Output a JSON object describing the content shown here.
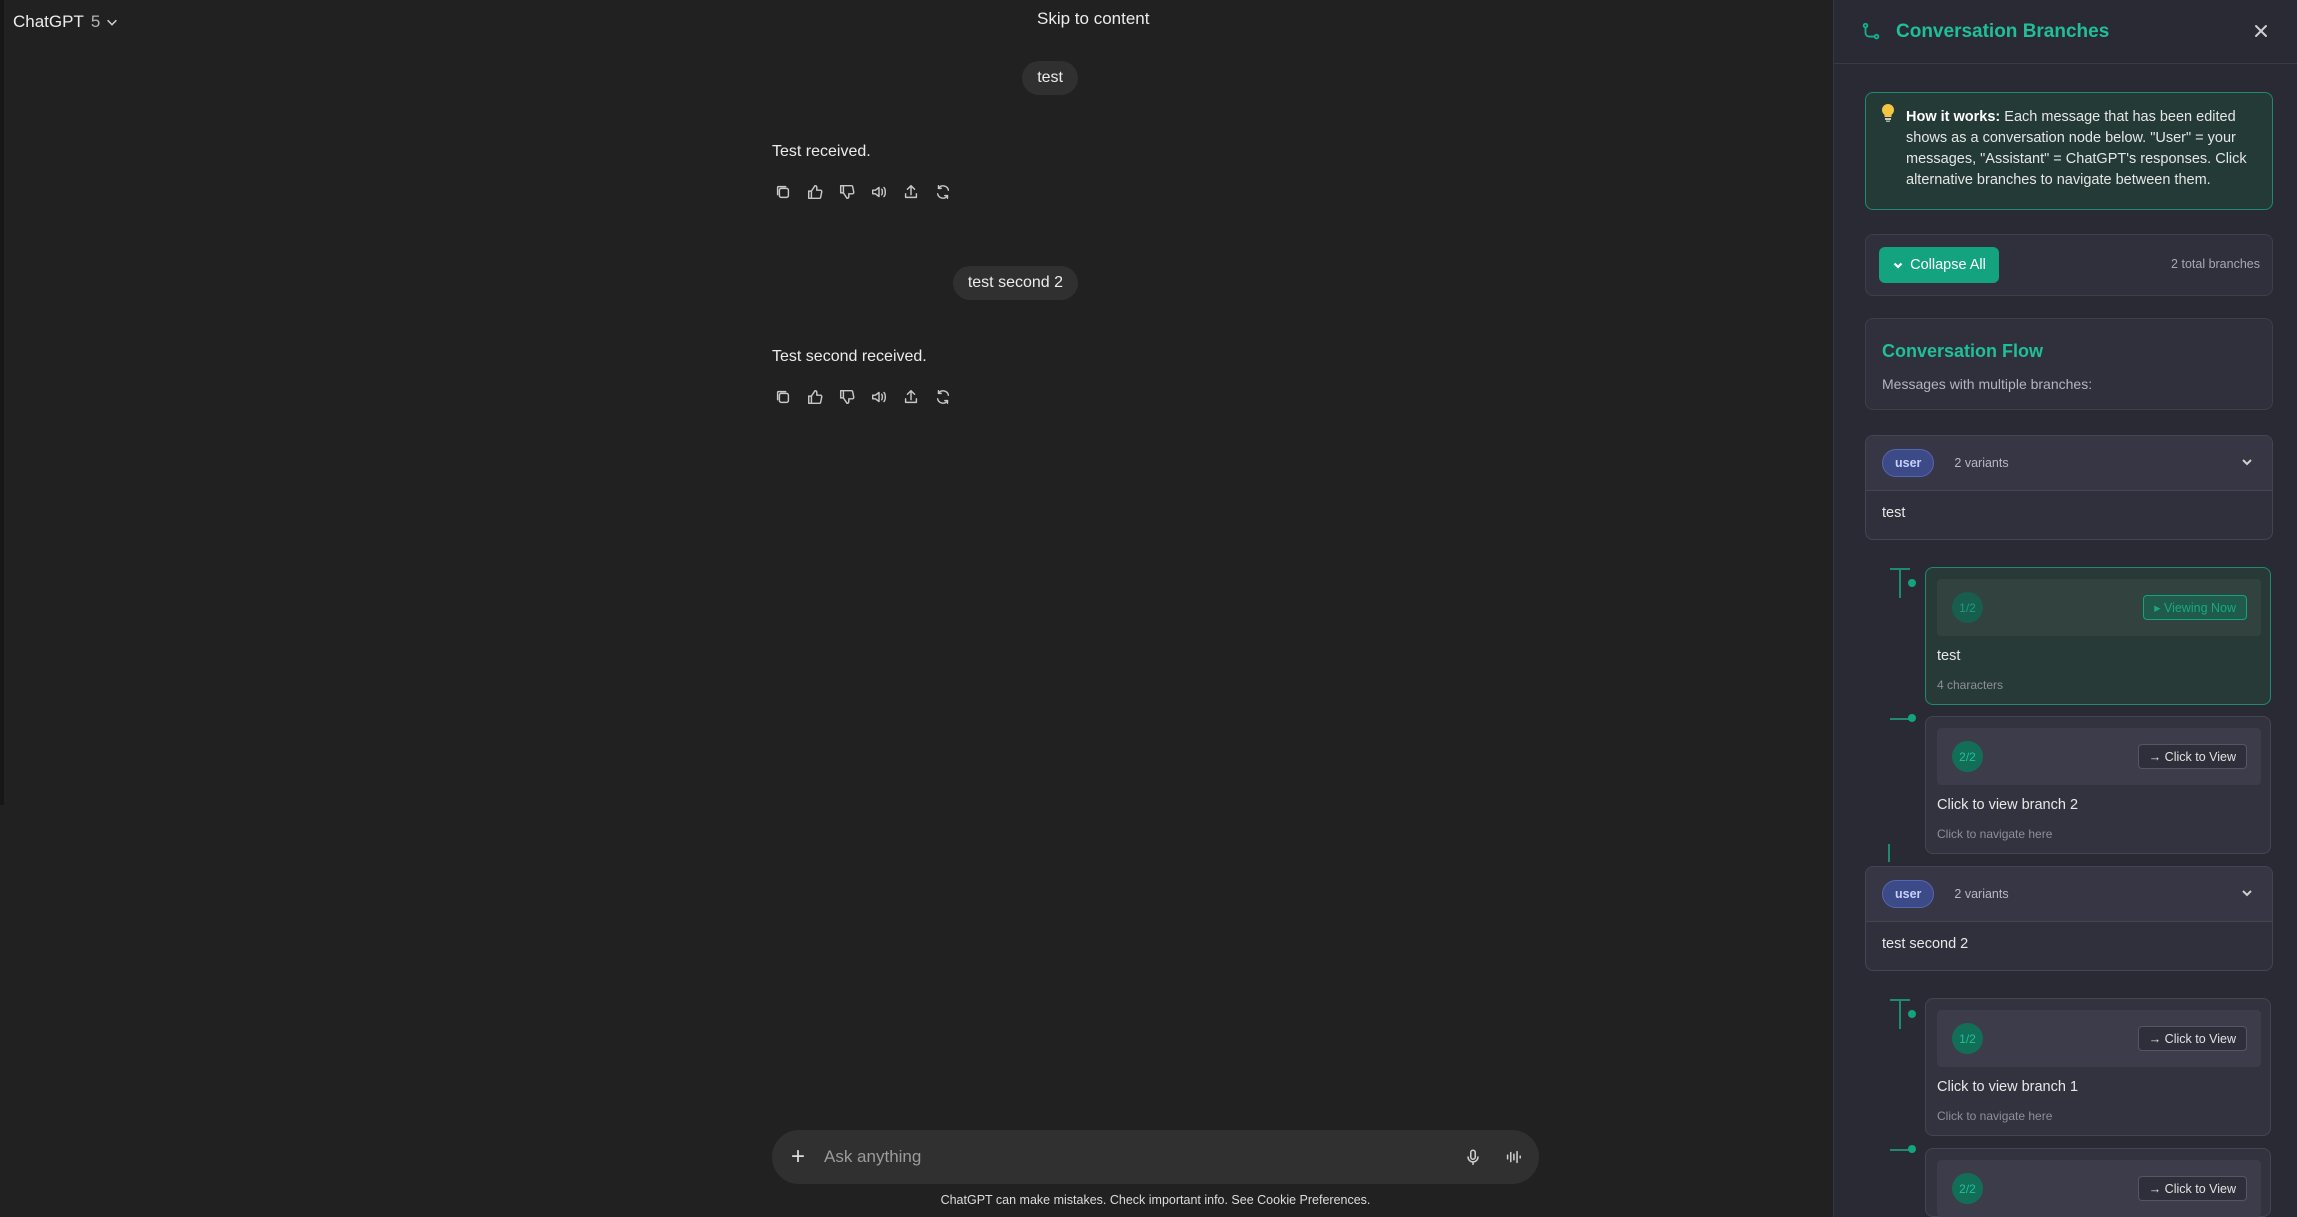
{
  "header": {
    "model_name": "ChatGPT",
    "model_version": "5",
    "skip_link": "Skip to content"
  },
  "messages": [
    {
      "role": "user",
      "text": "test"
    },
    {
      "role": "assistant",
      "text": "Test received."
    },
    {
      "role": "user",
      "text": "test second 2"
    },
    {
      "role": "assistant",
      "text": "Test second received."
    }
  ],
  "message_actions": [
    "copy-icon",
    "thumbs-up-icon",
    "thumbs-down-icon",
    "read-aloud-icon",
    "share-icon",
    "regenerate-icon"
  ],
  "composer": {
    "placeholder": "Ask anything"
  },
  "disclaimer": "ChatGPT can make mistakes. Check important info. See Cookie Preferences.",
  "panel": {
    "title": "Conversation Branches",
    "info_bold": "How it works:",
    "info_text": " Each message that has been edited shows as a conversation node below. \"User\" = your messages, \"Assistant\" = ChatGPT's responses. Click alternative branches to navigate between them.",
    "collapse_label": "Collapse All",
    "total_branches": "2 total branches",
    "flow_title": "Conversation Flow",
    "flow_subtitle": "Messages with multiple branches:",
    "nodes": [
      {
        "role": "user",
        "variants_label": "2 variants",
        "text": "test",
        "variants": [
          {
            "badge": "1/2",
            "button": "▸ Viewing Now",
            "text": "test",
            "meta": "4 characters",
            "active": true
          },
          {
            "badge": "2/2",
            "button": "→ Click to View",
            "text": "Click to view branch 2",
            "meta": "Click to navigate here",
            "active": false
          }
        ]
      },
      {
        "role": "user",
        "variants_label": "2 variants",
        "text": "test second 2",
        "variants": [
          {
            "badge": "1/2",
            "button": "→ Click to View",
            "text": "Click to view branch 1",
            "meta": "Click to navigate here",
            "active": false
          },
          {
            "badge": "2/2",
            "button": "→ Click to View",
            "text": "",
            "meta": "",
            "active": false
          }
        ]
      }
    ]
  },
  "colors": {
    "accent": "#13a37f",
    "panel_bg": "#2a2a35",
    "chat_bg": "#212121"
  }
}
